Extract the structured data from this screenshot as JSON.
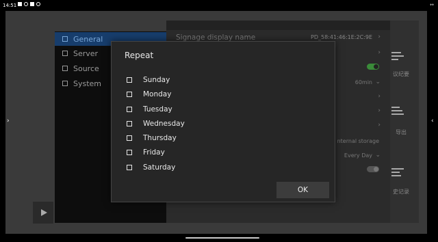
{
  "statusbar": {
    "time": "14:51",
    "icons": [
      "photo-icon",
      "signal-icon",
      "stop-icon",
      "record-icon"
    ],
    "right_icon": "↔"
  },
  "nav": {
    "left_arrow": "›",
    "right_arrow": "‹"
  },
  "sidebar": {
    "items": [
      {
        "label": "General",
        "icon": "wrench-icon",
        "active": true
      },
      {
        "label": "Server",
        "icon": "server-icon",
        "active": false
      },
      {
        "label": "Source",
        "icon": "source-icon",
        "active": false
      },
      {
        "label": "System",
        "icon": "system-icon",
        "active": false
      }
    ]
  },
  "panel": {
    "signage_label": "Signage display name",
    "signage_value": "PD_58:41:46:1E:2C:9E",
    "interval_value": "60min",
    "storage_text": "nternal storage",
    "schedule_value": "Every Day",
    "chevron": "›",
    "dropdown": "⌄"
  },
  "right_strip": {
    "items": [
      {
        "label": "议纪要",
        "icon": "notes-icon"
      },
      {
        "label": "导出",
        "icon": "export-icon"
      },
      {
        "label": "史记录",
        "icon": "history-icon"
      }
    ]
  },
  "dialog": {
    "title": "Repeat",
    "days": [
      "Sunday",
      "Monday",
      "Tuesday",
      "Wednesday",
      "Thursday",
      "Friday",
      "Saturday"
    ],
    "ok_label": "OK"
  },
  "colors": {
    "active_bg": "#173d6c",
    "toggle_on": "#3a8b39"
  }
}
